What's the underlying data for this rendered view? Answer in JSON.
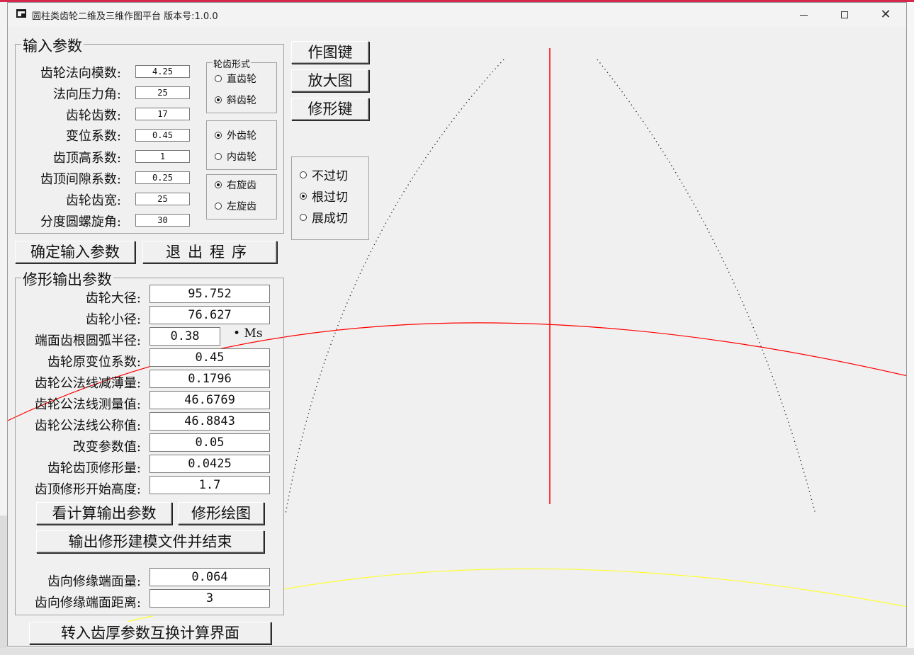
{
  "window": {
    "title": "圆柱类齿轮二维及三维作图平台 版本号:1.0.0"
  },
  "input_params": {
    "group_title": "输入参数",
    "fields": [
      {
        "label": "齿轮法向模数:",
        "value": "4.25"
      },
      {
        "label": "法向压力角:",
        "value": "25"
      },
      {
        "label": "齿轮齿数:",
        "value": "17"
      },
      {
        "label": "变位系数:",
        "value": "0.45"
      },
      {
        "label": "齿顶高系数:",
        "value": "1"
      },
      {
        "label": "齿顶间隙系数:",
        "value": "0.25"
      },
      {
        "label": "齿轮齿宽:",
        "value": "25"
      },
      {
        "label": "分度圆螺旋角:",
        "value": "30"
      }
    ],
    "tooth_form": {
      "title": "轮齿形式",
      "options": [
        {
          "label": "直齿轮",
          "selected": false
        },
        {
          "label": "斜齿轮",
          "selected": true
        }
      ]
    },
    "gear_type": {
      "options": [
        {
          "label": "外齿轮",
          "selected": true
        },
        {
          "label": "内齿轮",
          "selected": false
        }
      ]
    },
    "helix_hand": {
      "options": [
        {
          "label": "右旋齿",
          "selected": true
        },
        {
          "label": "左旋齿",
          "selected": false
        }
      ]
    }
  },
  "side_buttons": {
    "draw": "作图键",
    "zoom": "放大图",
    "modify": "修形键"
  },
  "undercut": {
    "options": [
      {
        "label": "不过切",
        "selected": false
      },
      {
        "label": "根过切",
        "selected": true
      },
      {
        "label": "展成切",
        "selected": false
      }
    ]
  },
  "confirm_button": "确定输入参数",
  "exit_button": "退出程序",
  "output_params": {
    "group_title": "修形输出参数",
    "fields": [
      {
        "label": "齿轮大径:",
        "value": "95.752"
      },
      {
        "label": "齿轮小径:",
        "value": "76.627"
      },
      {
        "label": "端面齿根圆弧半径:",
        "value": "0.38"
      },
      {
        "label": "齿轮原变位系数:",
        "value": "0.45"
      },
      {
        "label": "齿轮公法线减薄量:",
        "value": "0.1796"
      },
      {
        "label": "齿轮公法线测量值:",
        "value": "46.6769"
      },
      {
        "label": "齿轮公法线公称值:",
        "value": "46.8843"
      },
      {
        "label": "改变参数值:",
        "value": "0.05"
      },
      {
        "label": "齿轮齿顶修形量:",
        "value": "0.0425"
      },
      {
        "label": "齿顶修形开始高度:",
        "value": "1.7"
      }
    ],
    "ms_suffix": "• Ms",
    "view_calc_button": "看计算输出参数",
    "mod_draw_button": "修形绘图",
    "export_button": "输出修形建模文件并结束",
    "end_fields": [
      {
        "label": "齿向修缘端面量:",
        "value": "0.064"
      },
      {
        "label": "齿向修缘端面距离:",
        "value": "3"
      }
    ]
  },
  "convert_button": "转入齿厚参数互换计算界面",
  "colors": {
    "curve_red": "#ff0000",
    "curve_yellow": "#ffff33",
    "profile_dots": "#222222",
    "window_bg": "#f0f0f0"
  }
}
